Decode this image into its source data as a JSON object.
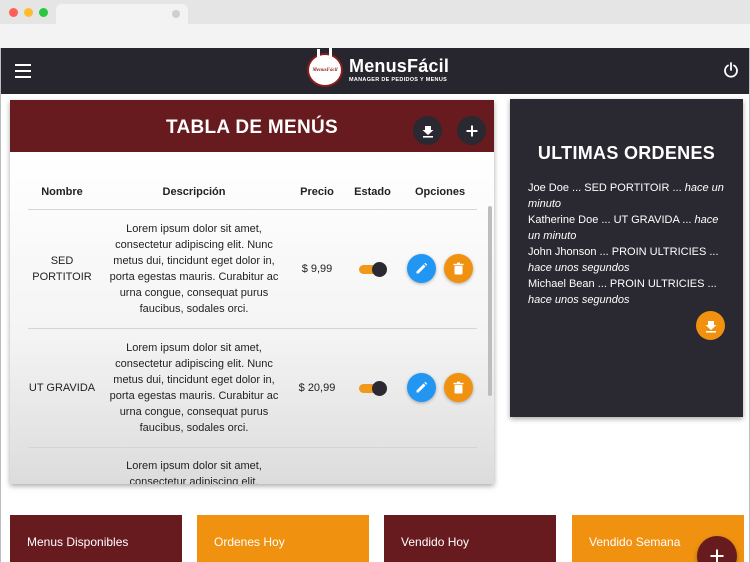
{
  "app": {
    "logo_badge": "MenusFácil",
    "logo_name": "MenusFácil",
    "logo_subtitle": "MANAGER DE PEDIDOS Y MENUS",
    "menu_icon": "hamburger-icon",
    "power_icon": "power-icon"
  },
  "menu_table": {
    "title": "TABLA DE MENÚS",
    "columns": [
      "Nombre",
      "Descripción",
      "Precio",
      "Estado",
      "Opciones"
    ],
    "rows": [
      {
        "name": "SED PORTITOIR",
        "description": "Lorem ipsum dolor sit amet, consectetur adipiscing elit. Nunc metus dui, tincidunt eget dolor in, porta egestas mauris. Curabitur ac urna congue, consequat purus faucibus, sodales orci.",
        "price": "$ 9,99",
        "active": true
      },
      {
        "name": "UT GRAVIDA",
        "description": "Lorem ipsum dolor sit amet, consectetur adipiscing elit. Nunc metus dui, tincidunt eget dolor in, porta egestas mauris. Curabitur ac urna congue, consequat purus faucibus, sodales orci.",
        "price": "$ 20,99",
        "active": true
      },
      {
        "name": "",
        "description": "Lorem ipsum dolor sit amet, consectetur adipiscing elit.",
        "price": "",
        "active": true
      }
    ]
  },
  "orders": {
    "title": "ULTIMAS ORDENES",
    "items": [
      {
        "text": "Joe Doe ... SED PORTITOIR ... ",
        "time": "hace un minuto"
      },
      {
        "text": "Katherine Doe ... UT GRAVIDA ... ",
        "time": "hace un minuto"
      },
      {
        "text": "John Jhonson ... PROIN ULTRICIES ... ",
        "time": "hace unos segundos"
      },
      {
        "text": "Michael Bean ... PROIN ULTRICIES ... ",
        "time": "hace unos segundos"
      }
    ]
  },
  "stats": [
    "Menus Disponibles",
    "Ordenes Hoy",
    "Vendido Hoy",
    "Vendido Semana"
  ],
  "colors": {
    "brand_red": "#681b1f",
    "accent_orange": "#f0920f",
    "dark": "#27252d",
    "edit_blue": "#2196f3"
  }
}
